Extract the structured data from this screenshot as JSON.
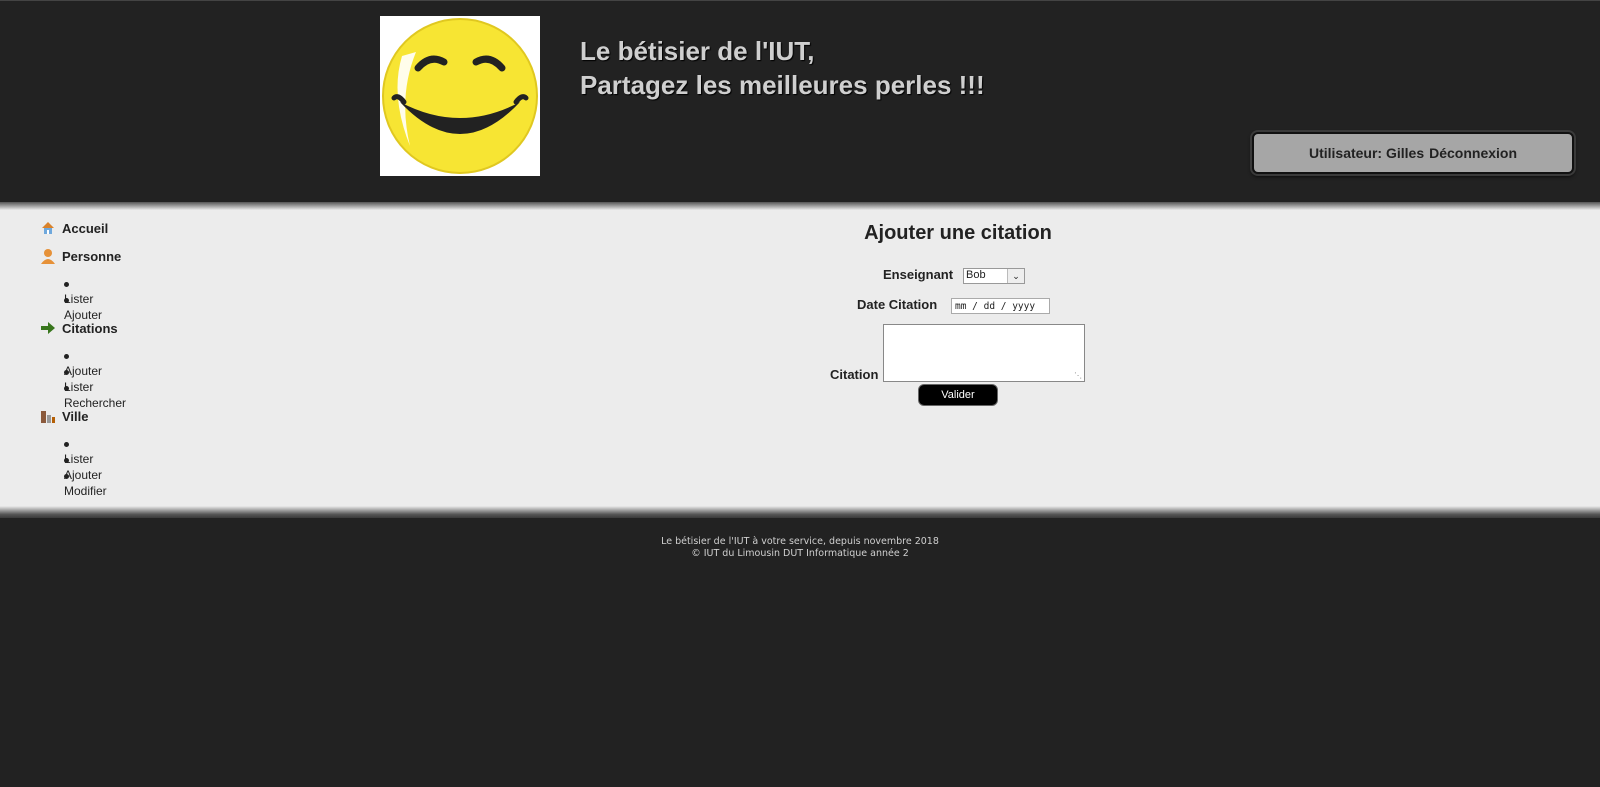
{
  "header": {
    "title_line1": "Le bétisier de l'IUT,",
    "title_line2": "Partagez les meilleures perles !!!",
    "user_label": "Utilisateur: Gilles",
    "logout_label": "Déconnexion"
  },
  "sidebar": {
    "sections": [
      {
        "label": "Accueil",
        "icon": "home-icon",
        "items": []
      },
      {
        "label": "Personne",
        "icon": "person-icon",
        "items": [
          "Lister",
          "Ajouter"
        ]
      },
      {
        "label": "Citations",
        "icon": "arrow-right-icon",
        "items": [
          "Ajouter",
          "Lister",
          "Rechercher"
        ]
      },
      {
        "label": "Ville",
        "icon": "city-icon",
        "items": [
          "Lister",
          "Ajouter",
          "Modifier"
        ]
      }
    ]
  },
  "form": {
    "title": "Ajouter une citation",
    "teacher_label": "Enseignant",
    "teacher_value": "Bob",
    "date_label": "Date Citation",
    "date_placeholder": "mm / dd / yyyy",
    "citation_label": "Citation",
    "submit_label": "Valider"
  },
  "footer": {
    "line1": "Le bétisier de l'IUT à votre service, depuis novembre 2018",
    "line2": "© IUT du Limousin DUT Informatique année 2"
  },
  "colors": {
    "background": "#222222",
    "content_bg": "#ececec",
    "title_text": "#cfcfcf",
    "smiley_yellow": "#f7e533"
  }
}
